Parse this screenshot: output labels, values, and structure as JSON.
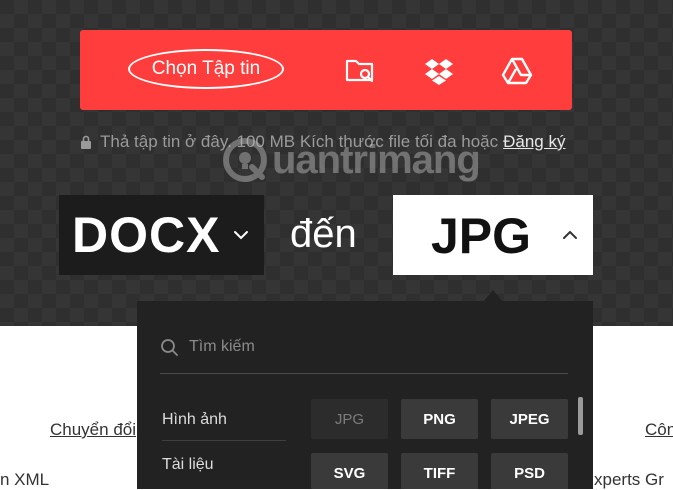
{
  "upload": {
    "choose_label": "Chọn Tập tin",
    "icons": [
      "folder-search-icon",
      "dropbox-icon",
      "google-drive-icon"
    ],
    "hint_text": "Thả tập tin ở đây. 100 MB Kích thước file tối đa hoặc",
    "signup_link": "Đăng ký"
  },
  "watermark": {
    "text": "uantrimang"
  },
  "converter": {
    "from_format": "DOCX",
    "to_label": "đến",
    "to_format": "JPG"
  },
  "dropdown": {
    "search_placeholder": "Tìm kiếm",
    "categories": [
      "Hình ảnh",
      "Tài liệu"
    ],
    "formats": [
      {
        "label": "JPG",
        "state": "disabled"
      },
      {
        "label": "PNG",
        "state": "enabled"
      },
      {
        "label": "JPEG",
        "state": "enabled"
      },
      {
        "label": "SVG",
        "state": "enabled"
      },
      {
        "label": "TIFF",
        "state": "enabled"
      },
      {
        "label": "PSD",
        "state": "enabled"
      }
    ]
  },
  "below": {
    "left_link": "Chuyển đổi",
    "right_link": "Côn",
    "left_text": "n XML",
    "right_text": "xperts Gr"
  },
  "colors": {
    "accent": "#ff3d3d",
    "dark_panel": "#222222",
    "format_button": "#3a3a3a"
  }
}
